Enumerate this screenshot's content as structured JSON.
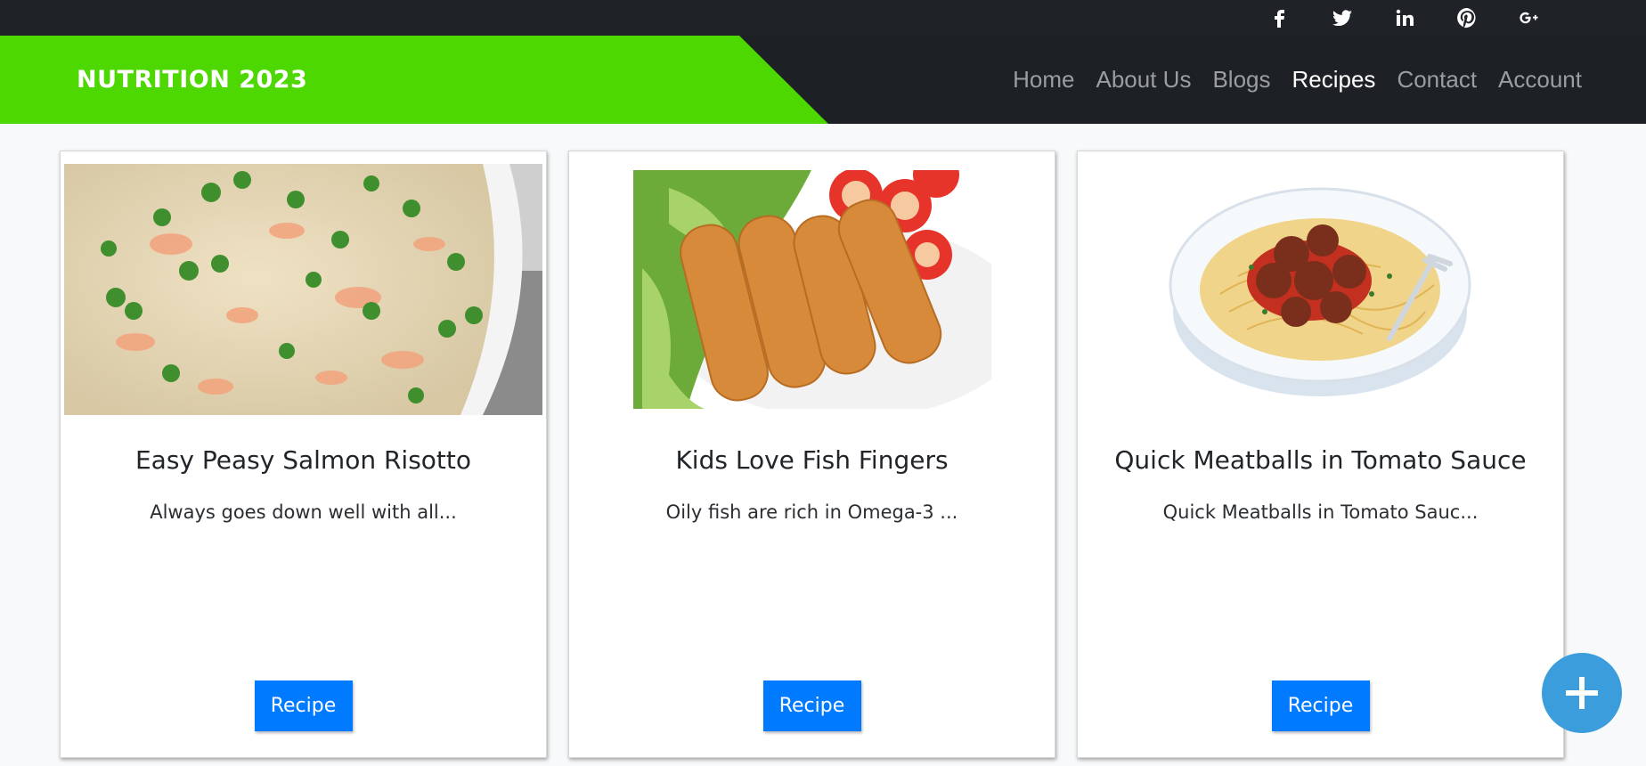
{
  "site": {
    "brand": "NUTRITION 2023"
  },
  "social": [
    {
      "name": "facebook-icon"
    },
    {
      "name": "twitter-icon"
    },
    {
      "name": "linkedin-icon"
    },
    {
      "name": "pinterest-icon"
    },
    {
      "name": "google-plus-icon"
    }
  ],
  "nav": {
    "items": [
      {
        "label": "Home",
        "active": false
      },
      {
        "label": "About Us",
        "active": false
      },
      {
        "label": "Blogs",
        "active": false
      },
      {
        "label": "Recipes",
        "active": true
      },
      {
        "label": "Contact",
        "active": false
      },
      {
        "label": "Account",
        "active": false
      }
    ]
  },
  "cards": [
    {
      "title": "Easy Peasy Salmon Risotto",
      "description": "Always goes down well with all...",
      "button": "Recipe",
      "image": "salmon-risotto-photo"
    },
    {
      "title": "Kids Love Fish Fingers",
      "description": "Oily fish are rich in Omega-3 ...",
      "button": "Recipe",
      "image": "fish-fingers-photo"
    },
    {
      "title": "Quick Meatballs in Tomato Sauce",
      "description": "Quick Meatballs in Tomato Sauc...",
      "button": "Recipe",
      "image": "meatballs-pasta-photo"
    }
  ],
  "fab": {
    "icon": "plus-icon"
  },
  "colors": {
    "brand_green": "#4cd800",
    "nav_bg": "#1d2024",
    "button_blue": "#007bff",
    "fab_blue": "#3c9ddc"
  }
}
